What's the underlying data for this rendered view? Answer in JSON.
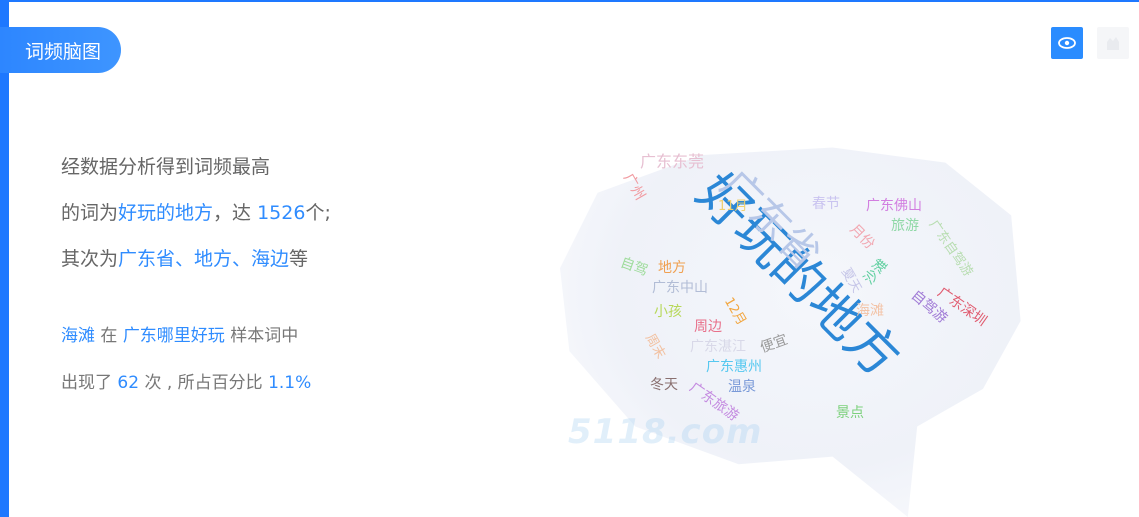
{
  "header": {
    "tab_label": "词频脑图"
  },
  "toolbar": {
    "view_icon": "eye-icon",
    "other_icon": "cloud-icon"
  },
  "summary": {
    "l1": "经数据分析得到词频最高",
    "l2_pre": "的词为",
    "l2_word": "好玩的地方",
    "l2_mid": "，达",
    "l2_count": "1526",
    "l2_post": "个;",
    "l3_pre": "其次为",
    "l3_words": "广东省、地方、海边",
    "l3_post": "等"
  },
  "sample": {
    "word": "海滩",
    "at": "在",
    "phrase": "广东哪里好玩",
    "suffix": "样本词中",
    "appeared": "出现了",
    "times": "62",
    "times_unit": "次 , 所占百分比",
    "percent": "1.1%"
  },
  "cloud": {
    "watermark": "5118.com",
    "words": [
      {
        "text": "好玩的地方",
        "color": "#2b87d6"
      },
      {
        "text": "广东省",
        "color": "#b7c7e8"
      },
      {
        "text": "广东东莞",
        "color": "#e7c0d2"
      },
      {
        "text": "广州",
        "color": "#f19aa0"
      },
      {
        "text": "春节",
        "color": "#c9c3f0"
      },
      {
        "text": "广东佛山",
        "color": "#d27ee0"
      },
      {
        "text": "旅游",
        "color": "#8fd8a6"
      },
      {
        "text": "月份",
        "color": "#f2a6b0"
      },
      {
        "text": "广东自驾游",
        "color": "#b7ddb0"
      },
      {
        "text": "自驾",
        "color": "#9fdc9c"
      },
      {
        "text": "地方",
        "color": "#f0a050"
      },
      {
        "text": "沙滩",
        "color": "#5fcf9f"
      },
      {
        "text": "广东中山",
        "color": "#b2bdd6"
      },
      {
        "text": "夏天",
        "color": "#c6c6e8"
      },
      {
        "text": "自驾游",
        "color": "#a07ad6"
      },
      {
        "text": "广东深圳",
        "color": "#e05b6f"
      },
      {
        "text": "小孩",
        "color": "#b7d85a"
      },
      {
        "text": "12月",
        "color": "#f2a640"
      },
      {
        "text": "海滩",
        "color": "#f3c3a6"
      },
      {
        "text": "周边",
        "color": "#e8708a"
      },
      {
        "text": "周末",
        "color": "#f2c0a0"
      },
      {
        "text": "广东湛江",
        "color": "#d8d8e8"
      },
      {
        "text": "便宜",
        "color": "#9a9a9a"
      },
      {
        "text": "广东惠州",
        "color": "#56c8f0"
      },
      {
        "text": "温泉",
        "color": "#7a9ad8"
      },
      {
        "text": "冬天",
        "color": "#8a7070"
      },
      {
        "text": "广东旅游",
        "color": "#c48ae0"
      },
      {
        "text": "景点",
        "color": "#7cd17c"
      },
      {
        "text": "11月",
        "color": "#f0d070"
      }
    ]
  }
}
